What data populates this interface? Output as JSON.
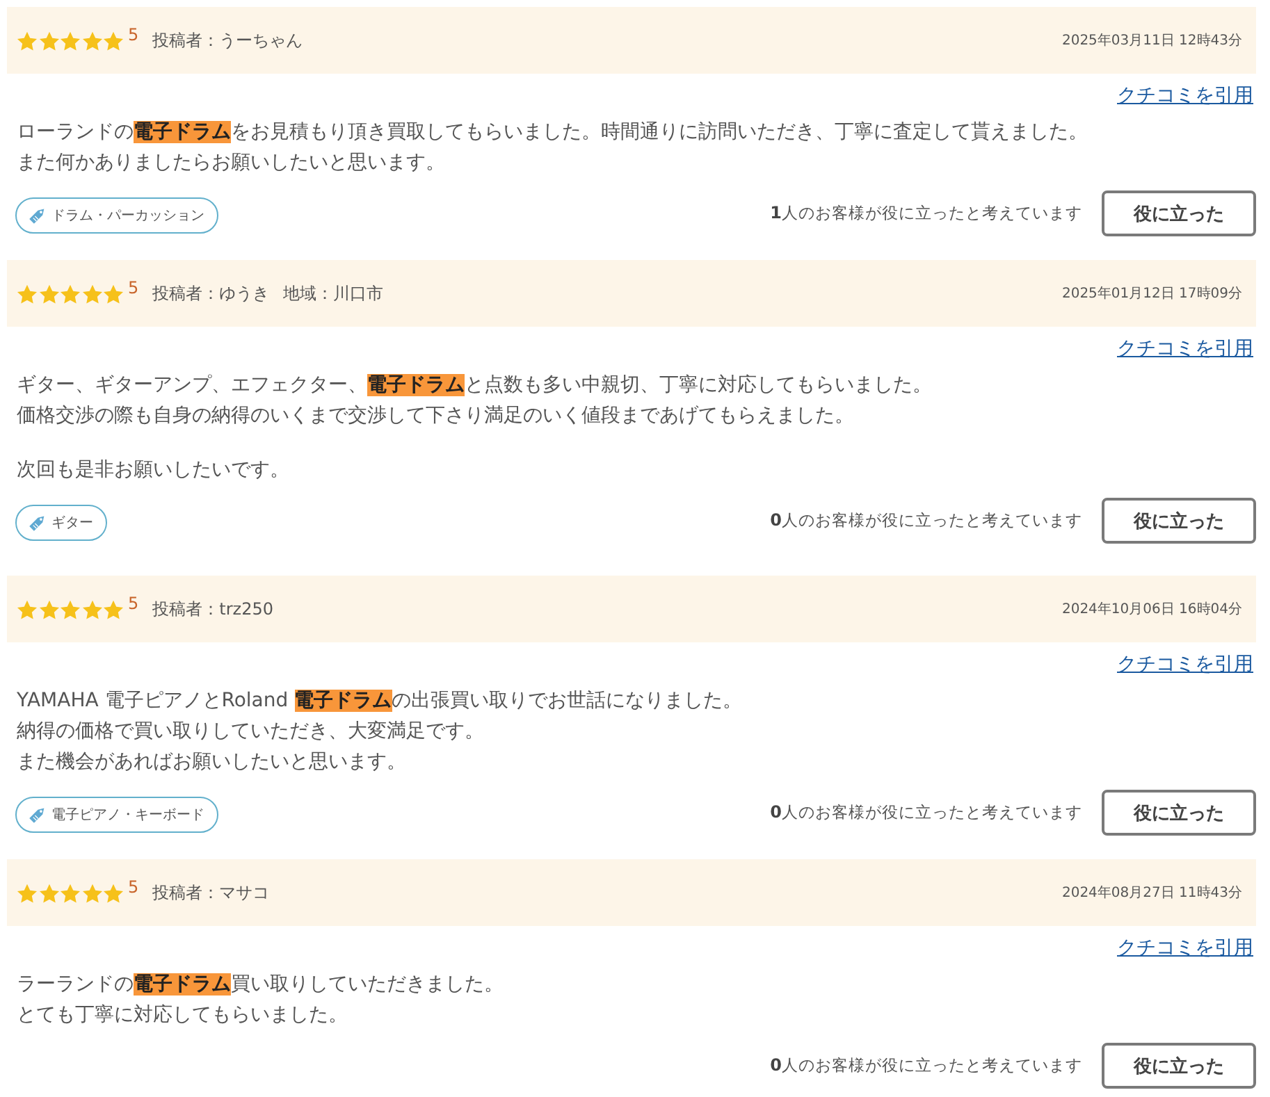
{
  "reviews": [
    {
      "stars": 5,
      "rating": "5",
      "meta": [
        "投稿者：うーちゃん"
      ],
      "date": "2025年03月11日 12時43分",
      "quote_link": "クチコミを引用",
      "body": [
        [
          "ローランドの**電子ドラム**をお見積もり頂き買取してもらいました。時間通りに訪問いただき、丁寧に査定して貰えました。",
          "また何かありましたらお願いしたいと思います。"
        ]
      ],
      "tag": "ドラム・パーカッション",
      "helpful_text": "**1**人のお客様が役に立ったと考えています",
      "helpful_button": "役に立った"
    },
    {
      "stars": 5,
      "rating": "5",
      "meta": [
        "投稿者：ゆうき",
        "地域：川口市"
      ],
      "date": "2025年01月12日 17時09分",
      "quote_link": "クチコミを引用",
      "body": [
        [
          "ギター、ギターアンプ、エフェクター、**電子ドラム**と点数も多い中親切、丁寧に対応してもらいました。",
          "価格交渉の際も自身の納得のいくまで交渉して下さり満足のいく値段まであげてもらえました。"
        ],
        [
          "次回も是非お願いしたいです。"
        ]
      ],
      "tag": "ギター",
      "helpful_text": "**0**人のお客様が役に立ったと考えています",
      "helpful_button": "役に立った"
    },
    {
      "stars": 5,
      "rating": "5",
      "meta": [
        "投稿者：trz250"
      ],
      "date": "2024年10月06日 16時04分",
      "quote_link": "クチコミを引用",
      "body": [
        [
          "YAMAHA 電子ピアノとRoland **電子ドラム**の出張買い取りでお世話になりました。",
          "納得の価格で買い取りしていただき、大変満足です。",
          "また機会があればお願いしたいと思います。"
        ]
      ],
      "tag": "電子ピアノ・キーボード",
      "helpful_text": "**0**人のお客様が役に立ったと考えています",
      "helpful_button": "役に立った"
    },
    {
      "stars": 5,
      "rating": "5",
      "meta": [
        "投稿者：マサコ"
      ],
      "date": "2024年08月27日 11時43分",
      "quote_link": "クチコミを引用",
      "body": [
        [
          "ラーランドの**電子ドラム**買い取りしていただきました。",
          "とても丁寧に対応してもらいました。"
        ]
      ],
      "helpful_text": "**0**人のお客様が役に立ったと考えています",
      "helpful_button": "役に立った"
    }
  ]
}
